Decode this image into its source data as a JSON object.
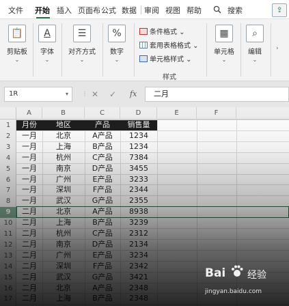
{
  "tabs": [
    {
      "label": "文件",
      "active": false
    },
    {
      "label": "开始",
      "active": true
    },
    {
      "label": "插入",
      "active": false
    },
    {
      "label": "页面布",
      "active": false
    },
    {
      "label": "公式",
      "active": false
    },
    {
      "label": "数据",
      "active": false
    },
    {
      "label": "审阅",
      "active": false
    },
    {
      "label": "视图",
      "active": false
    },
    {
      "label": "帮助",
      "active": false
    }
  ],
  "search": {
    "icon": "search-icon",
    "label": "搜索"
  },
  "share": {
    "icon": "share-icon"
  },
  "ribbon": {
    "clipboard": {
      "label": "剪贴板",
      "icon": "clipboard-icon"
    },
    "font": {
      "label": "字体",
      "icon": "font-icon"
    },
    "alignment": {
      "label": "对齐方式",
      "icon": "align-icon"
    },
    "number": {
      "label": "数字",
      "icon": "percent-icon"
    },
    "conditional_format": "条件格式",
    "table_format": "套用表格格式",
    "cell_styles": "单元格样式",
    "styles_group": "样式",
    "cells": {
      "label": "单元格",
      "icon": "cells-icon"
    },
    "editing": {
      "label": "编辑",
      "icon": "search-icon"
    }
  },
  "formula_bar": {
    "name_box": "1R",
    "cancel": "✕",
    "enter": "✓",
    "fx": "fx",
    "value": "二月"
  },
  "sheet": {
    "columns": [
      "A",
      "B",
      "C",
      "D",
      "E",
      "F"
    ],
    "rows": [
      "1",
      "2",
      "3",
      "4",
      "5",
      "6",
      "7",
      "8",
      "9",
      "10",
      "11",
      "12",
      "13",
      "14",
      "15",
      "16",
      "17"
    ],
    "selected_row": 9,
    "header": [
      "月份",
      "地区",
      "产品",
      "销售量"
    ],
    "data": [
      [
        "一月",
        "北京",
        "A产品",
        "1234"
      ],
      [
        "一月",
        "上海",
        "B产品",
        "1234"
      ],
      [
        "一月",
        "杭州",
        "C产品",
        "7384"
      ],
      [
        "一月",
        "南京",
        "D产品",
        "3455"
      ],
      [
        "一月",
        "广州",
        "E产品",
        "3233"
      ],
      [
        "一月",
        "深圳",
        "F产品",
        "2344"
      ],
      [
        "一月",
        "武汉",
        "G产品",
        "2355"
      ],
      [
        "二月",
        "北京",
        "A产品",
        "8938"
      ],
      [
        "二月",
        "上海",
        "B产品",
        "3239"
      ],
      [
        "二月",
        "杭州",
        "C产品",
        "2312"
      ],
      [
        "二月",
        "南京",
        "D产品",
        "2134"
      ],
      [
        "二月",
        "广州",
        "E产品",
        "3234"
      ],
      [
        "二月",
        "深圳",
        "F产品",
        "2342"
      ],
      [
        "二月",
        "武汉",
        "G产品",
        "3421"
      ],
      [
        "二月",
        "北京",
        "A产品",
        "2348"
      ],
      [
        "二月",
        "上海",
        "B产品",
        "2348"
      ]
    ]
  },
  "watermark": {
    "brand": "Bai",
    "brand_cn": "经验",
    "url": "jingyan.baidu.com"
  }
}
